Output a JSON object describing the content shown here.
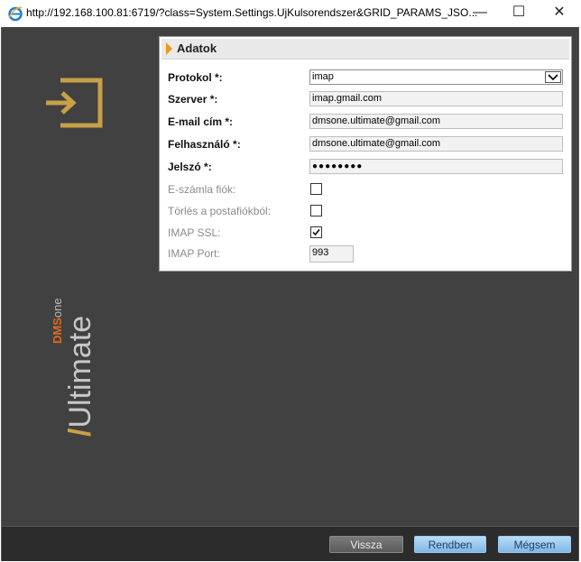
{
  "window": {
    "url": "http://192.168.100.81:6719/?class=System.Settings.UjKulsorendszer&GRID_PARAMS_JSO...",
    "minimize_label": "—",
    "maximize_label": "☐",
    "close_label": "✕"
  },
  "sidebar": {
    "exit_icon": "exit-door-arrow-icon",
    "logo": {
      "brand_dms": "DMS",
      "brand_one": "one",
      "product": "/Ultimate",
      "colors": {
        "accent": "#c8a048",
        "dms_orange": "#e06a1a",
        "text": "#c7c7c7"
      }
    }
  },
  "panel": {
    "title": "Adatok",
    "fields": {
      "protocol": {
        "label": "Protokol *:",
        "value": "imap"
      },
      "server": {
        "label": "Szerver *:",
        "value": "imap.gmail.com"
      },
      "email": {
        "label": "E-mail cím *:",
        "value": "dmsone.ultimate@gmail.com"
      },
      "user": {
        "label": "Felhasználó *:",
        "value": "dmsone.ultimate@gmail.com"
      },
      "password": {
        "label": "Jelszó *:",
        "value": "●●●●●●●●"
      },
      "einvoice": {
        "label": "E-számla fiók:",
        "checked": false
      },
      "delete": {
        "label": "Törlés a postafiókból:",
        "checked": false
      },
      "ssl": {
        "label": "IMAP SSL:",
        "checked": true
      },
      "port": {
        "label": "IMAP Port:",
        "value": "993"
      }
    }
  },
  "buttons": {
    "back": "Vissza",
    "ok": "Rendben",
    "cancel": "Mégsem"
  }
}
